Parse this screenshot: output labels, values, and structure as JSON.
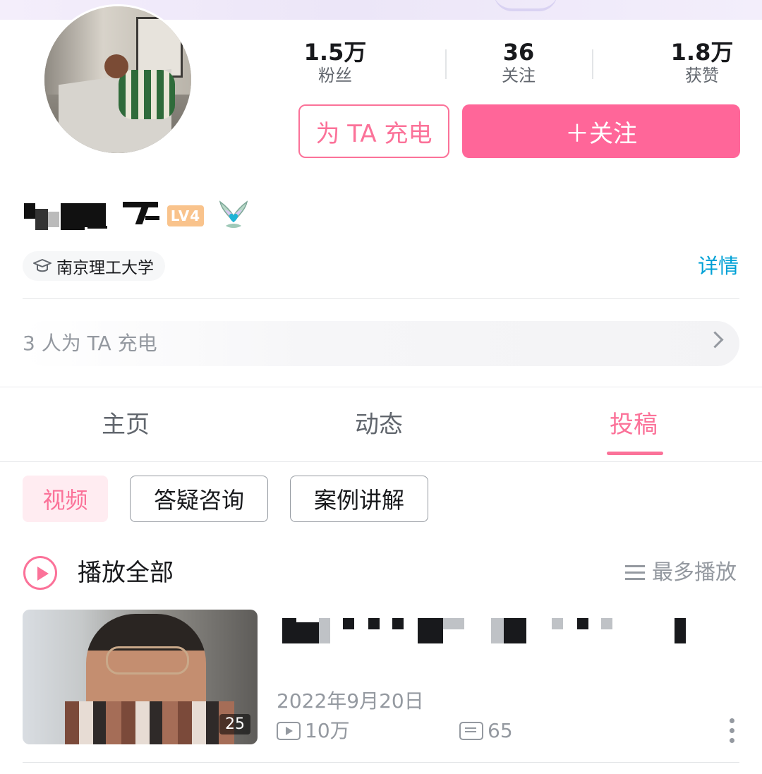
{
  "profile": {
    "stats": [
      {
        "value": "1.5万",
        "label": "粉丝"
      },
      {
        "value": "36",
        "label": "关注"
      },
      {
        "value": "1.8万",
        "label": "获赞"
      }
    ],
    "charge_button": "为 TA 充电",
    "follow_button": "＋关注",
    "level_badge": "LV4",
    "school": "南京理工大学",
    "detail_link": "详情",
    "charge_summary": "3 人为 TA 充电"
  },
  "tabs": [
    {
      "label": "主页"
    },
    {
      "label": "动态"
    },
    {
      "label": "投稿",
      "active": true
    }
  ],
  "filters": [
    {
      "label": "视频",
      "active": true
    },
    {
      "label": "答疑咨询"
    },
    {
      "label": "案例讲解"
    }
  ],
  "list_header": {
    "play_all": "播放全部",
    "sort": "最多播放"
  },
  "videos": [
    {
      "duration": "25",
      "date": "2022年9月20日",
      "views": "10万",
      "comments": "65"
    }
  ],
  "colors": {
    "accent": "#fb7299",
    "follow_bg": "#ff6699",
    "link": "#00a1d6"
  }
}
